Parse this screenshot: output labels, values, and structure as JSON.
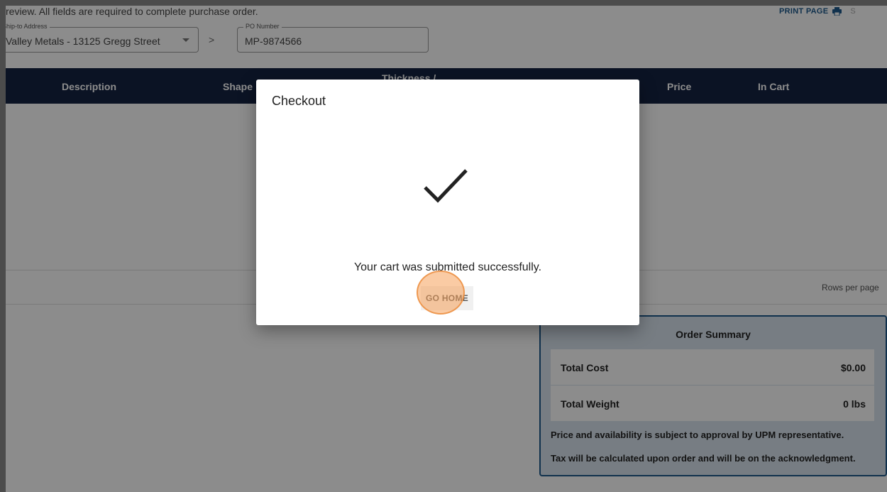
{
  "header": {
    "intro": "review. All fields are required to complete purchase order.",
    "print_label": "PRINT PAGE",
    "print_icon": "printer-icon",
    "trailing": "S"
  },
  "ship_to": {
    "label": "Ship-to Address",
    "value": "Valley Metals - 13125 Gregg Street"
  },
  "po": {
    "label": "PO Number",
    "value": "MP-9874566"
  },
  "table": {
    "columns": [
      "Description",
      "Shape",
      "Thickness /",
      "Price",
      "In Cart"
    ],
    "rows_per_page_label": "Rows per page"
  },
  "summary": {
    "title": "Order Summary",
    "rows": [
      {
        "label": "Total Cost",
        "value": "$0.00"
      },
      {
        "label": "Total Weight",
        "value": "0 lbs"
      }
    ],
    "notes": [
      "Price and availability is subject to approval by UPM representative.",
      "Tax will be calculated upon order and will be on the acknowledgment."
    ]
  },
  "modal": {
    "title": "Checkout",
    "icon": "checkmark-icon",
    "message": "Your cart was submitted successfully.",
    "button": "GO HOME"
  },
  "colors": {
    "header_bg": "#152342",
    "accent": "#1e5a8c",
    "summary_bg": "#d9e4ee"
  }
}
